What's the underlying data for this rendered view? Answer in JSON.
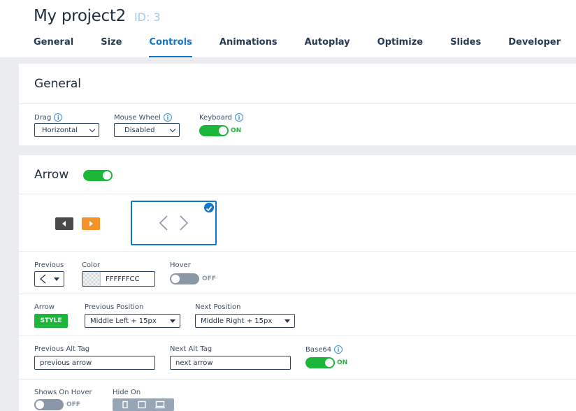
{
  "project": {
    "title": "My project2",
    "id_label": "ID: 3"
  },
  "tabs": [
    {
      "label": "General"
    },
    {
      "label": "Size"
    },
    {
      "label": "Controls",
      "active": true
    },
    {
      "label": "Animations"
    },
    {
      "label": "Autoplay"
    },
    {
      "label": "Optimize"
    },
    {
      "label": "Slides"
    },
    {
      "label": "Developer"
    }
  ],
  "general": {
    "title": "General",
    "drag": {
      "label": "Drag",
      "value": "Horizontal"
    },
    "mouse_wheel": {
      "label": "Mouse Wheel",
      "value": "Disabled"
    },
    "keyboard": {
      "label": "Keyboard",
      "state": "ON"
    }
  },
  "arrow": {
    "title": "Arrow",
    "title_toggle": "on",
    "previous": {
      "label": "Previous"
    },
    "color": {
      "label": "Color",
      "value": "FFFFFFCC"
    },
    "hover": {
      "label": "Hover",
      "state": "OFF"
    },
    "arrow_style": {
      "label": "Arrow",
      "button": "STYLE"
    },
    "previous_position": {
      "label": "Previous Position",
      "value": "Middle Left + 15px"
    },
    "next_position": {
      "label": "Next Position",
      "value": "Middle Right + 15px"
    },
    "previous_alt": {
      "label": "Previous Alt Tag",
      "value": "previous arrow"
    },
    "next_alt": {
      "label": "Next Alt Tag",
      "value": "next arrow"
    },
    "base64": {
      "label": "Base64",
      "state": "ON"
    },
    "shows_on_hover": {
      "label": "Shows On Hover",
      "state": "OFF"
    },
    "hide_on": {
      "label": "Hide On"
    }
  },
  "colors": {
    "accent_blue": "#1375c9",
    "toggle_green": "#1cb63a",
    "arrow_dark": "#4a4a4a",
    "arrow_orange": "#f5922a"
  },
  "icons": [
    "info-icon",
    "chevron-down-icon",
    "check-icon",
    "arrow-left-icon",
    "arrow-right-icon",
    "mobile-icon",
    "tablet-icon",
    "desktop-icon"
  ]
}
